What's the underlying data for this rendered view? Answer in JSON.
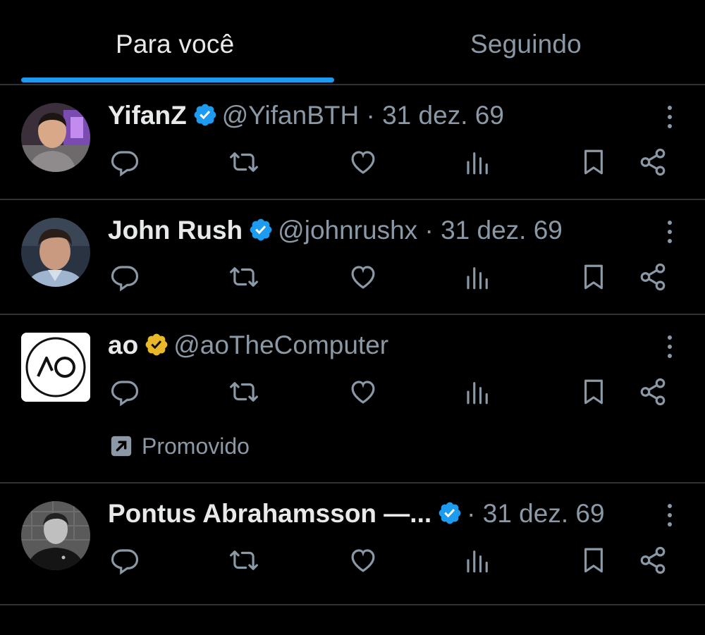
{
  "tabs": [
    {
      "label": "Para você",
      "active": true
    },
    {
      "label": "Seguindo",
      "active": false
    }
  ],
  "colors": {
    "accent": "#1d9bf0",
    "gold_badge": "#e8b829",
    "muted": "#8b98a5"
  },
  "tweets": [
    {
      "name": "YifanZ",
      "badge": "verified-blue",
      "handle": "@YifanBTH",
      "separator": "·",
      "date": "31 dez. 69",
      "promoted": false
    },
    {
      "name": "John Rush",
      "badge": "verified-blue",
      "handle": "@johnrushx",
      "separator": "·",
      "date": "31 dez. 69",
      "promoted": false
    },
    {
      "name": "ao",
      "badge": "verified-gold",
      "handle": "@aoTheComputer",
      "separator": "",
      "date": "",
      "promoted": true,
      "promo_label": "Promovido",
      "avatar_text": "AO"
    },
    {
      "name": "Pontus Abrahamsson —...",
      "badge": "verified-blue",
      "handle": "",
      "separator": "·",
      "date": "31 dez. 69",
      "promoted": false
    }
  ],
  "action_icons": [
    "reply-icon",
    "retweet-icon",
    "like-icon",
    "views-icon",
    "bookmark-icon",
    "share-icon"
  ]
}
